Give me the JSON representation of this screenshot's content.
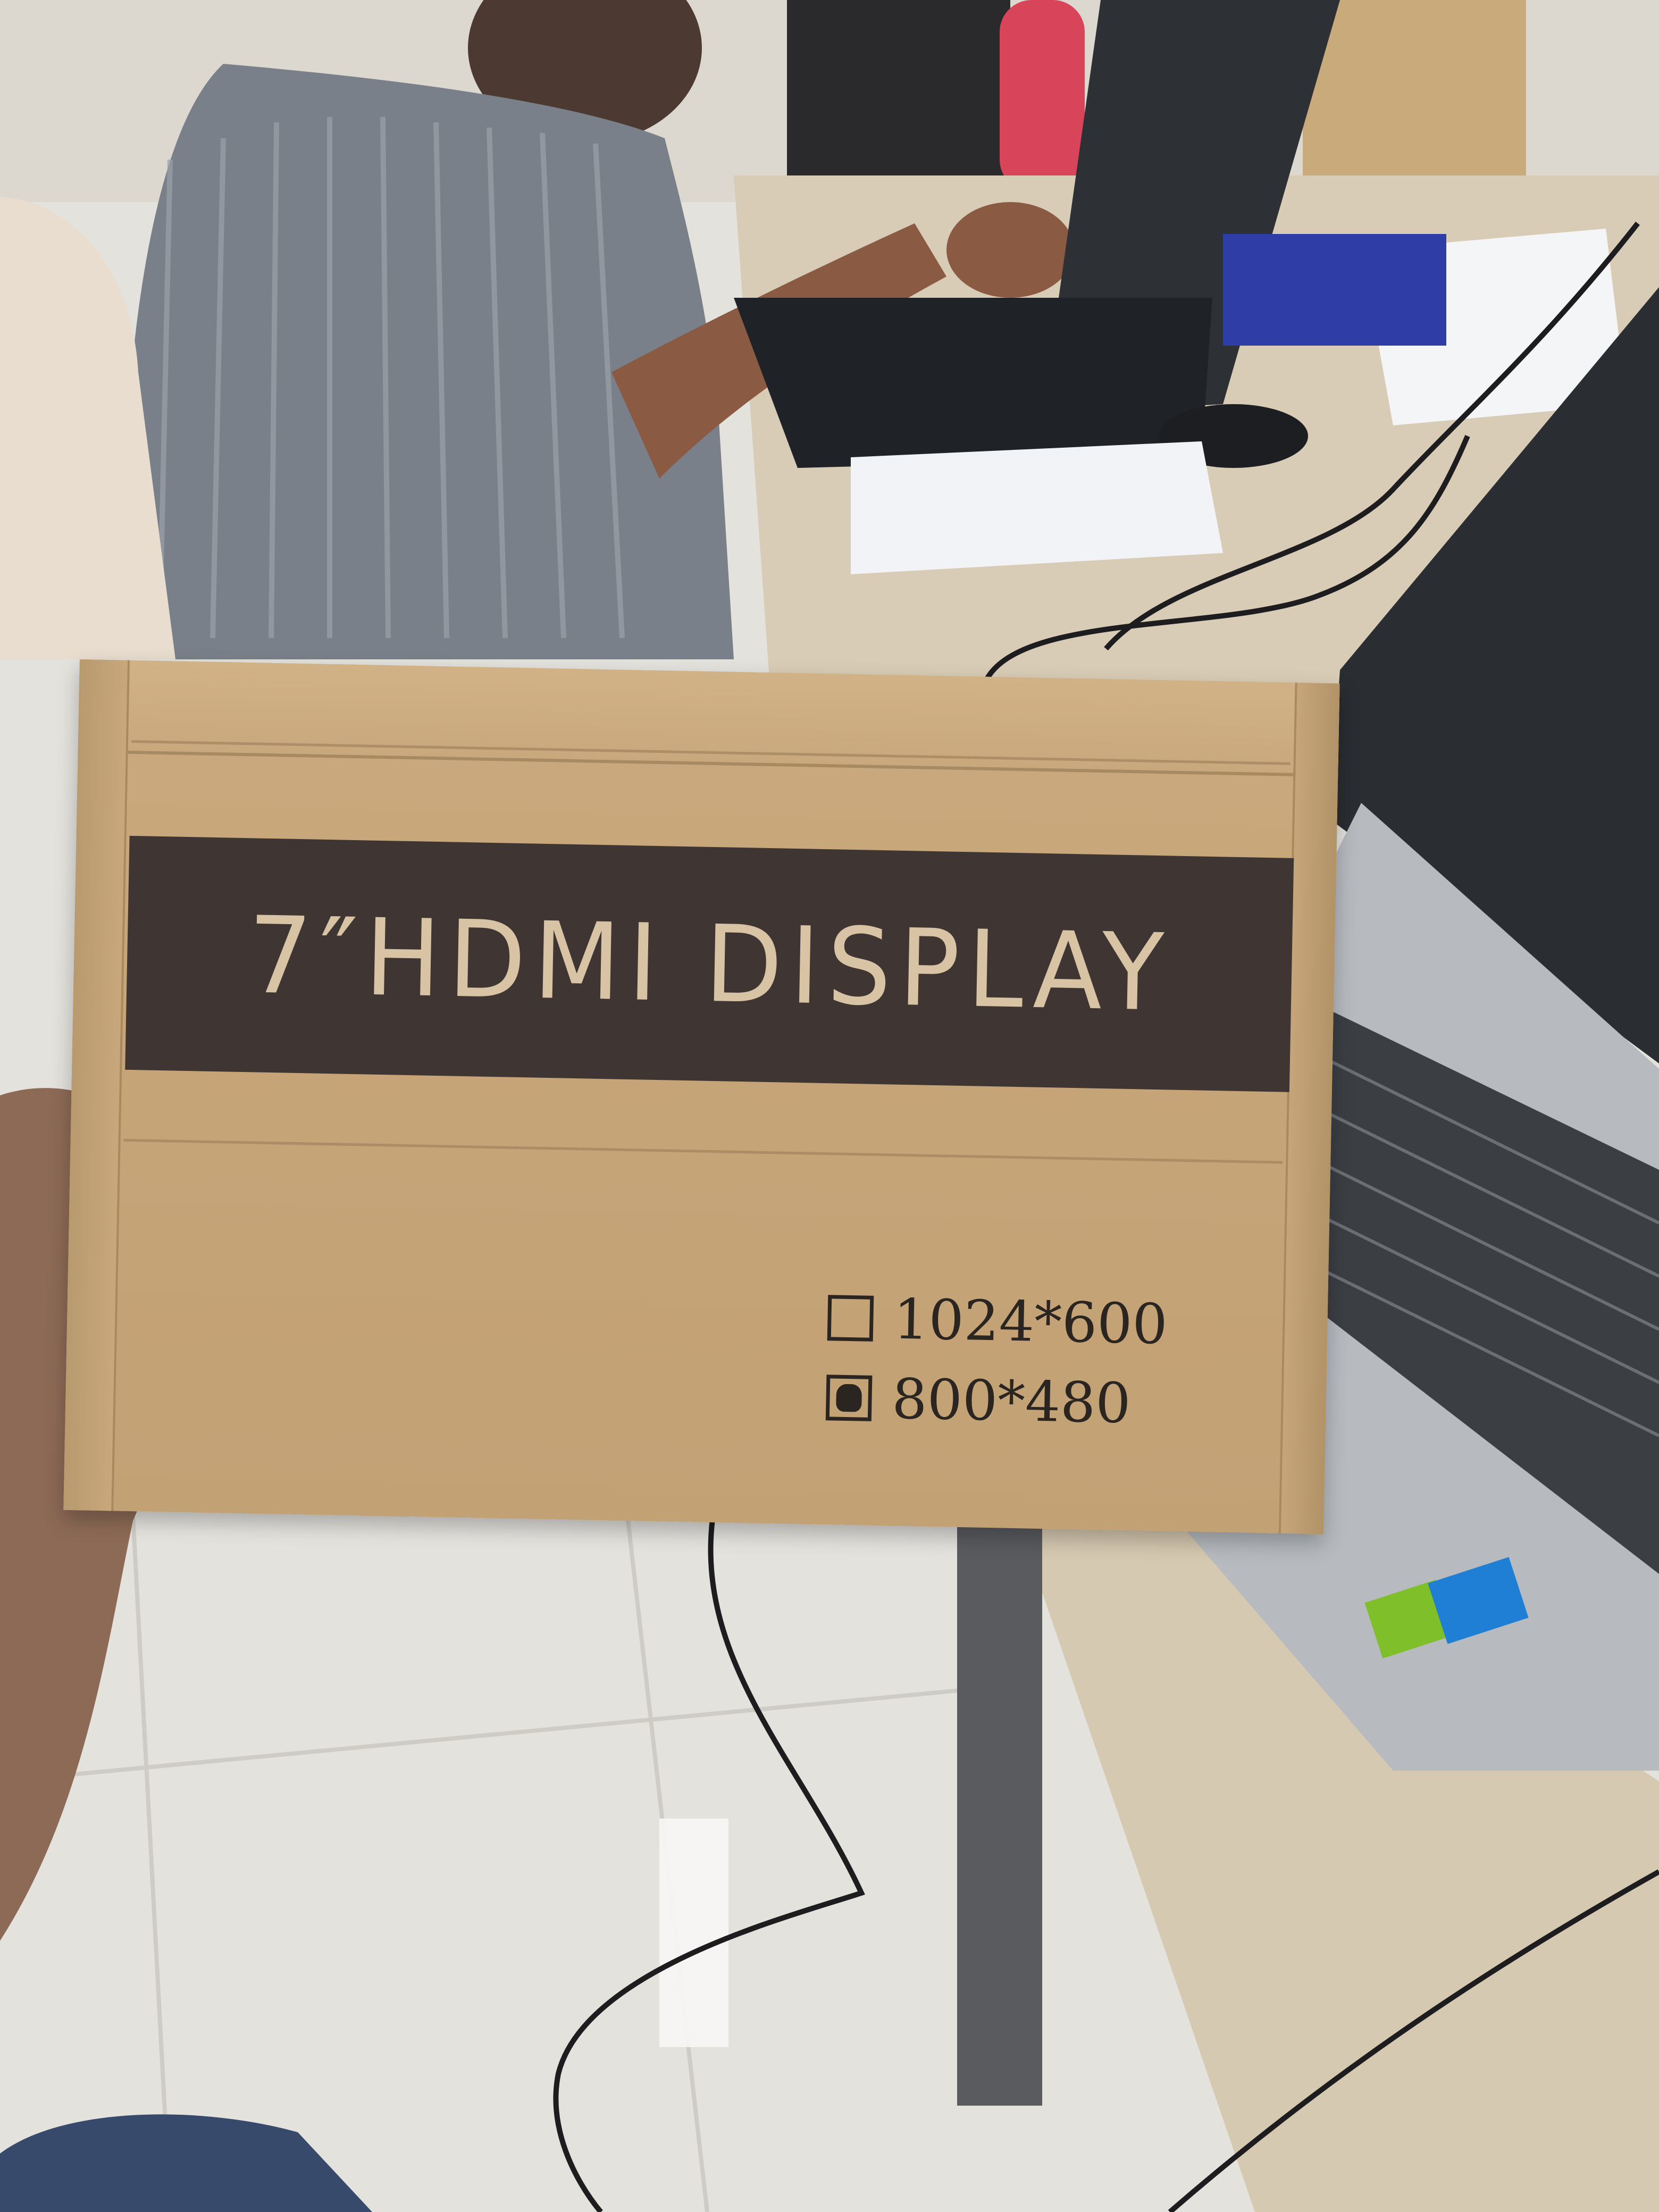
{
  "box": {
    "title": "7″HDMI DISPLAY",
    "resolution_options": [
      {
        "label": "1024*600",
        "checked": false
      },
      {
        "label": "800*480",
        "checked": true
      }
    ]
  },
  "colors": {
    "cardboard": "#c6a579",
    "banner": "#3f3634",
    "banner_text": "#d8c4a4",
    "floor": "#e3e1dc",
    "desk": "#d8cbb4",
    "laptop_body": "#b9bcbf"
  }
}
